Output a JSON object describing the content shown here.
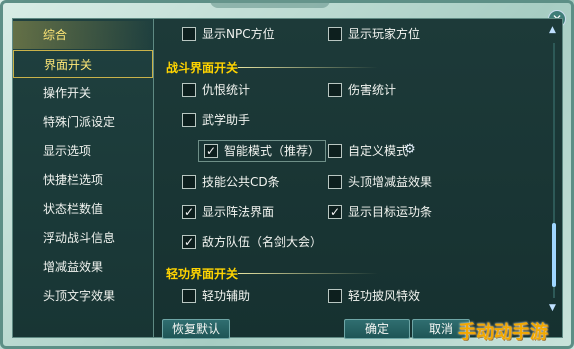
{
  "nav": {
    "items": [
      {
        "label": "综合"
      },
      {
        "label": "界面开关"
      },
      {
        "label": "操作开关"
      },
      {
        "label": "特殊门派设定"
      },
      {
        "label": "显示选项"
      },
      {
        "label": "快捷栏选项"
      },
      {
        "label": "状态栏数值"
      },
      {
        "label": "浮动战斗信息"
      },
      {
        "label": "增减益效果"
      },
      {
        "label": "头顶文字效果"
      }
    ]
  },
  "panel": {
    "top_row": {
      "left": {
        "label": "显示NPC方位",
        "checked": false
      },
      "right": {
        "label": "显示玩家方位",
        "checked": false
      }
    },
    "section1": {
      "title": "战斗界面开关"
    },
    "options": {
      "hate_stat": {
        "label": "仇恨统计",
        "checked": false
      },
      "damage_stat": {
        "label": "伤害统计",
        "checked": false
      },
      "martial_helper": {
        "label": "武学助手",
        "checked": false
      },
      "smart_mode": {
        "label": "智能模式（推荐）",
        "checked": true
      },
      "custom_mode": {
        "label": "自定义模式",
        "checked": false
      },
      "skill_cd": {
        "label": "技能公共CD条",
        "checked": false
      },
      "head_buff": {
        "label": "头顶增减益效果",
        "checked": false
      },
      "formation_ui": {
        "label": "显示阵法界面",
        "checked": true
      },
      "target_bar": {
        "label": "显示目标运功条",
        "checked": true
      },
      "enemy_team": {
        "label": "敌方队伍（名剑大会）",
        "checked": true
      }
    },
    "section2": {
      "title": "轻功界面开关"
    },
    "options2": {
      "qinggong_aux": {
        "label": "轻功辅助",
        "checked": false
      },
      "qinggong_wind": {
        "label": "轻功披风特效",
        "checked": false
      }
    }
  },
  "buttons": {
    "restore": "恢复默认",
    "ok": "确定",
    "cancel": "取消"
  },
  "watermark": "手动动手游",
  "colors": {
    "accent": "#ffd400",
    "panel_bg": "#1d3a39",
    "nav_selected": "#ffe777"
  }
}
